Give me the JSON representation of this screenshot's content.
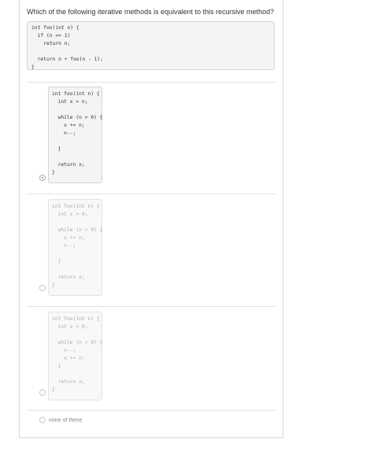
{
  "question": {
    "text": "Which of the following iterative methods is equivalent to this recursive method?",
    "code": "int foo(int n) {\n  if (n <= 1)\n    return n;\n\n  return n + foo(n - 1);\n}"
  },
  "options": [
    {
      "code": "int foo(int n) {\n  int x = n;\n\n  while (n > 0) {\n    x += n;\n    n--;\n\n  }\n\n  return x;\n}",
      "selected": true
    },
    {
      "code": "int foo(int n) {\n  int x = 0;\n\n  while (n > 0) {\n    x += n;\n    n--;\n\n  }\n\n  return x;\n}",
      "selected": false
    },
    {
      "code": "int foo(int n) {\n  int x = 0;\n\n  while (n > 0) {\n    n--;\n    x += n;\n  }\n\n  return x;\n}",
      "selected": false
    },
    {
      "label": "none of these",
      "selected": false
    }
  ]
}
